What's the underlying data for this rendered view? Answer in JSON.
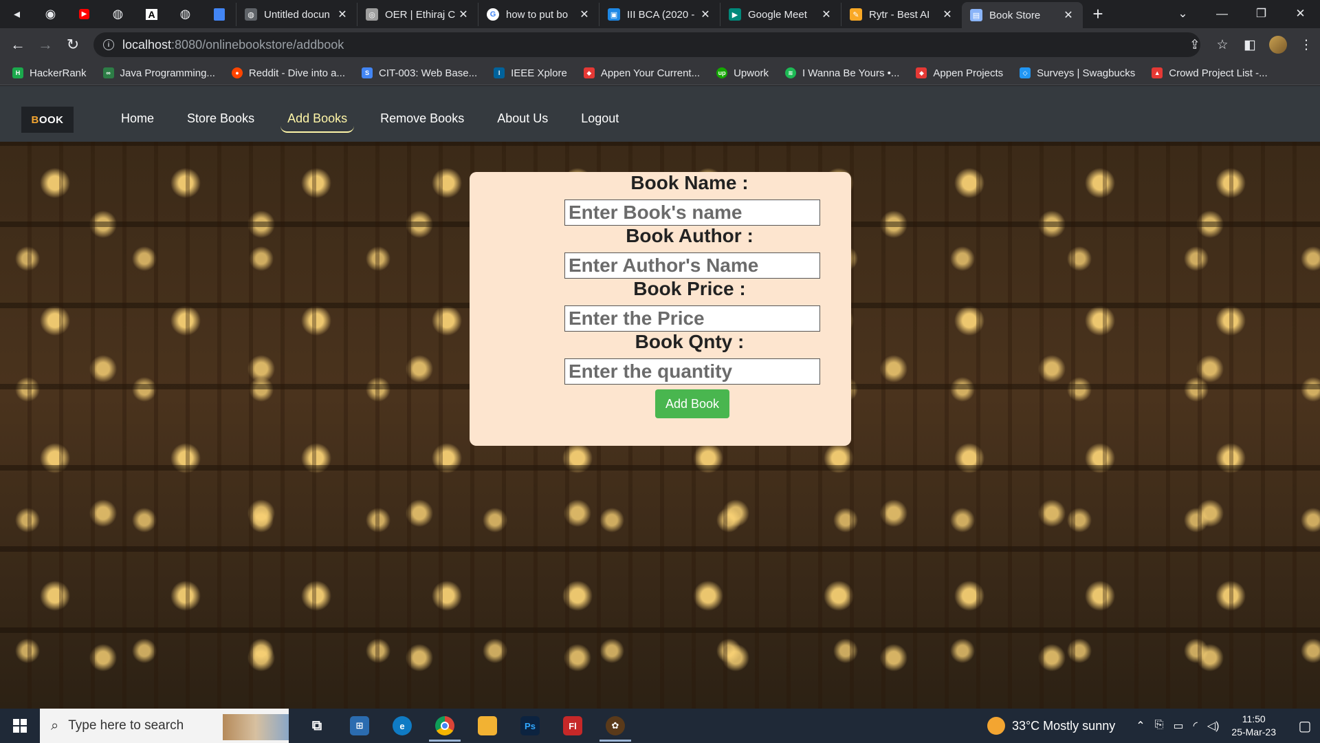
{
  "browser": {
    "tabs": [
      {
        "title": "Untitled docun",
        "favicon": "globe-icon"
      },
      {
        "title": "OER | Ethiraj C",
        "favicon": "site-icon"
      },
      {
        "title": "how to put bo",
        "favicon": "google-icon"
      },
      {
        "title": "III BCA (2020 -",
        "favicon": "classroom-icon"
      },
      {
        "title": "Google Meet",
        "favicon": "meet-icon"
      },
      {
        "title": "Rytr - Best AI",
        "favicon": "rytr-icon"
      },
      {
        "title": "Book Store",
        "favicon": "page-icon"
      }
    ],
    "active_tab_index": 6,
    "url_host": "localhost",
    "url_path": ":8080/onlinebookstore/addbook",
    "bookmarks": [
      {
        "label": "HackerRank",
        "color": "#1ba94c"
      },
      {
        "label": "Java Programming...",
        "color": "#2d7d46"
      },
      {
        "label": "Reddit - Dive into a...",
        "color": "#ff4500"
      },
      {
        "label": "CIT-003: Web Base...",
        "color": "#4285f4"
      },
      {
        "label": "IEEE Xplore",
        "color": "#00629b"
      },
      {
        "label": "Appen Your Current...",
        "color": "#e53935"
      },
      {
        "label": "Upwork",
        "color": "#14a800"
      },
      {
        "label": "I Wanna Be Yours •...",
        "color": "#1db954"
      },
      {
        "label": "Appen Projects",
        "color": "#e53935"
      },
      {
        "label": "Surveys | Swagbucks",
        "color": "#2196f3"
      },
      {
        "label": "Crowd Project List -...",
        "color": "#e53935"
      }
    ]
  },
  "site": {
    "logo_part1": "B",
    "logo_part2": "OOK",
    "nav": [
      "Home",
      "Store Books",
      "Add Books",
      "Remove Books",
      "About Us",
      "Logout"
    ],
    "active_nav_index": 2
  },
  "form": {
    "name_label": "Book Name :",
    "name_placeholder": "Enter Book's name",
    "author_label": "Book Author :",
    "author_placeholder": "Enter Author's Name",
    "price_label": "Book Price :",
    "price_placeholder": "Enter the Price",
    "qty_label": "Book Qnty :",
    "qty_placeholder": "Enter the quantity",
    "submit_label": "Add Book"
  },
  "taskbar": {
    "search_placeholder": "Type here to search",
    "apps": [
      {
        "name": "task-view-icon",
        "label": "⧉",
        "color": "transparent"
      },
      {
        "name": "microsoft-store-icon",
        "label": "⊞",
        "color": "#2b6cb0"
      },
      {
        "name": "edge-icon",
        "label": "e",
        "color": "#0f7bc4"
      },
      {
        "name": "chrome-icon",
        "label": "●",
        "color": "#db4437"
      },
      {
        "name": "file-explorer-icon",
        "label": "▬",
        "color": "#f2b233"
      },
      {
        "name": "photoshop-icon",
        "label": "Ps",
        "color": "#0c2340"
      },
      {
        "name": "flash-icon",
        "label": "Fl",
        "color": "#c62828"
      },
      {
        "name": "app-icon",
        "label": "✿",
        "color": "#5a3a1a"
      }
    ],
    "weather": "33°C  Mostly sunny",
    "time": "11:50",
    "date": "25-Mar-23"
  }
}
